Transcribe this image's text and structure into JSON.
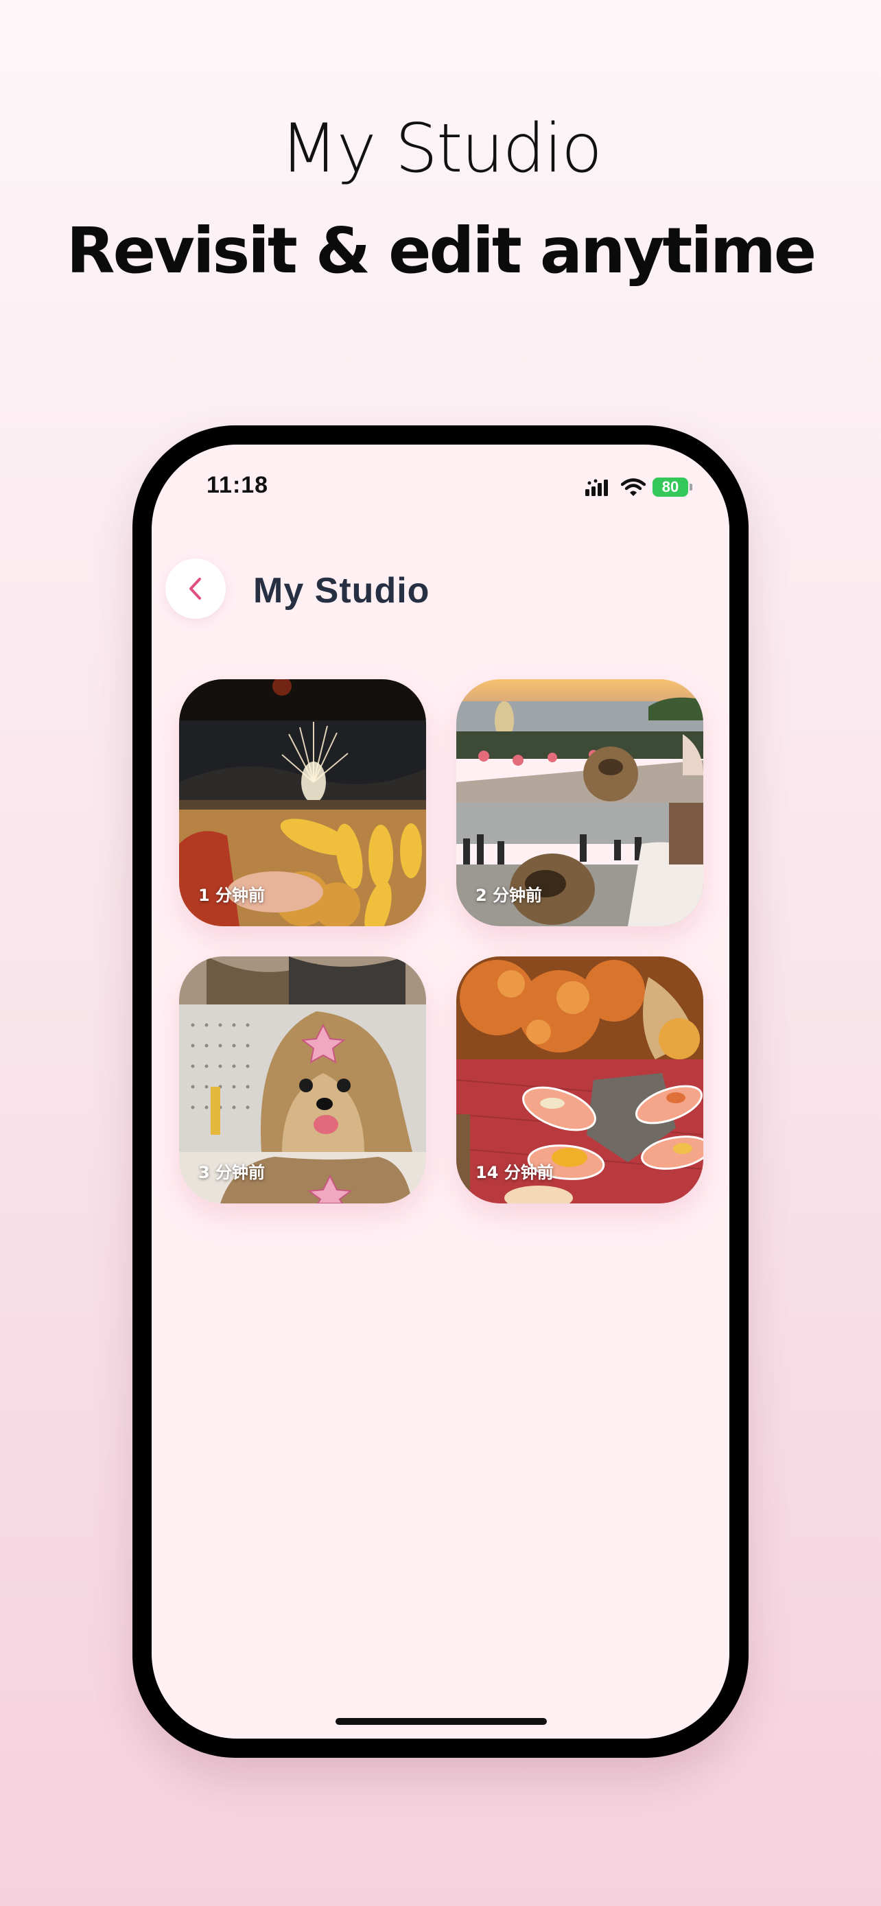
{
  "promo": {
    "title": "My Studio",
    "subtitle": "Revisit & edit anytime"
  },
  "status_bar": {
    "time": "11:18",
    "battery": "80"
  },
  "header": {
    "back_icon": "chevron-left-icon",
    "title": "My Studio"
  },
  "projects": [
    {
      "time": "1 分钟前",
      "thumbnail": "fireworks-and-corn"
    },
    {
      "time": "2 分钟前",
      "thumbnail": "sunset-lake-and-dog"
    },
    {
      "time": "3 分钟前",
      "thumbnail": "yorkshire-terrier"
    },
    {
      "time": "14 分钟前",
      "thumbnail": "salmon-sushi"
    }
  ],
  "colors": {
    "accent": "#e0507e",
    "title_text": "#263042",
    "screen_bg": "#fff0f4",
    "battery_green": "#34c759"
  }
}
